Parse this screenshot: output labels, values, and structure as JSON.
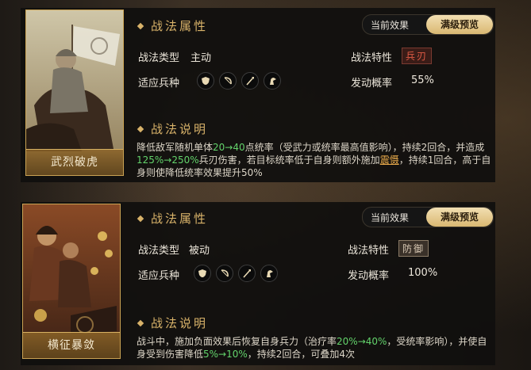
{
  "cards": [
    {
      "general_name": "武烈破虎",
      "attr_header": "战法属性",
      "toggle": {
        "current": "当前效果",
        "max": "满级预览"
      },
      "type_label": "战法类型",
      "type_value": "主动",
      "trait_label": "战法特性",
      "trait_value": "兵刃",
      "troops_label": "适应兵种",
      "troop_icons": [
        "shield-icon",
        "bow-icon",
        "spear-icon",
        "horse-icon"
      ],
      "rate_label": "发动概率",
      "rate_value": "55%",
      "desc_header": "战法说明",
      "desc": {
        "p1": "降低敌军随机单体",
        "g1": "20→40",
        "p2": "点统率（受武力或统率最高值影响），持续2回合，并造成",
        "g2": "125%→250%",
        "p3": "兵刃伤害，若目标统率低于自身则额外施加",
        "link": "震慑",
        "p4": "，持续1回合，高于自身则使降低统率效果提升50%"
      }
    },
    {
      "general_name": "横征暴敛",
      "attr_header": "战法属性",
      "toggle": {
        "current": "当前效果",
        "max": "满级预览"
      },
      "type_label": "战法类型",
      "type_value": "被动",
      "trait_label": "战法特性",
      "trait_value": "防御",
      "troops_label": "适应兵种",
      "troop_icons": [
        "shield-icon",
        "bow-icon",
        "spear-icon",
        "horse-icon"
      ],
      "rate_label": "发动概率",
      "rate_value": "100%",
      "desc_header": "战法说明",
      "desc": {
        "p1": "战斗中，施加负面效果后恢复自身兵力（治疗率",
        "g1": "20%→40%",
        "p2": "，受统率影响），并使自身受到伤害降低",
        "g2": "5%→10%",
        "p3": "，持续2回合，可叠加4次"
      }
    }
  ],
  "colors": {
    "accent_gold": "#d9b36a",
    "number_green": "#63d36b",
    "blade_red": "#e25b45"
  }
}
